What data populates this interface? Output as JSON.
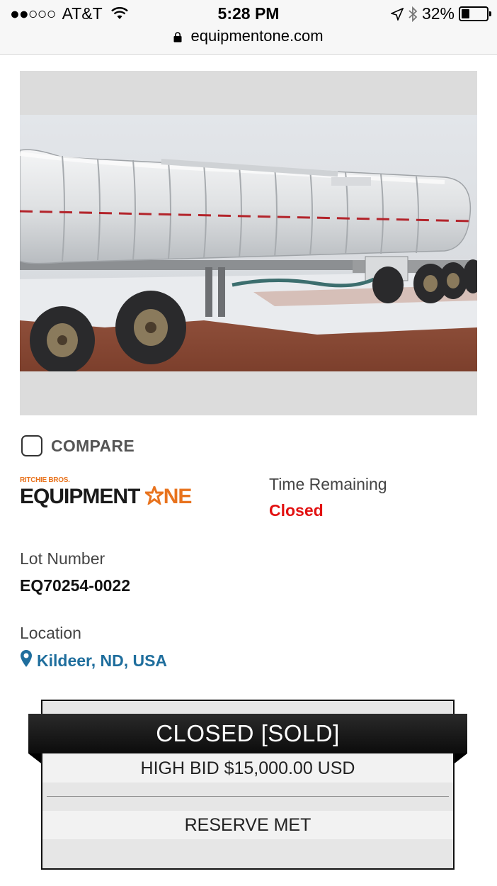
{
  "status_bar": {
    "carrier": "AT&T",
    "signal_dots": "●●○○○",
    "time": "5:28 PM",
    "battery": "32%",
    "battery_level": 0.32,
    "url": "equipmentone.com"
  },
  "listing": {
    "compare_label": "COMPARE",
    "logo": {
      "small_text": "RITCHIE BROS.",
      "main_text": "EQUIPMENT",
      "one_text": "NE"
    },
    "time_remaining_label": "Time Remaining",
    "time_remaining_value": "Closed",
    "lot_label": "Lot Number",
    "lot_value": "EQ70254-0022",
    "location_label": "Location",
    "location_value": "Kildeer, ND, USA"
  },
  "bid_panel": {
    "status": "CLOSED [SOLD]",
    "high_bid": "HIGH BID $15,000.00 USD",
    "reserve": "RESERVE MET"
  },
  "colors": {
    "closed_red": "#e21111",
    "link_blue": "#1f6e9d",
    "brand_orange": "#e8731e"
  }
}
